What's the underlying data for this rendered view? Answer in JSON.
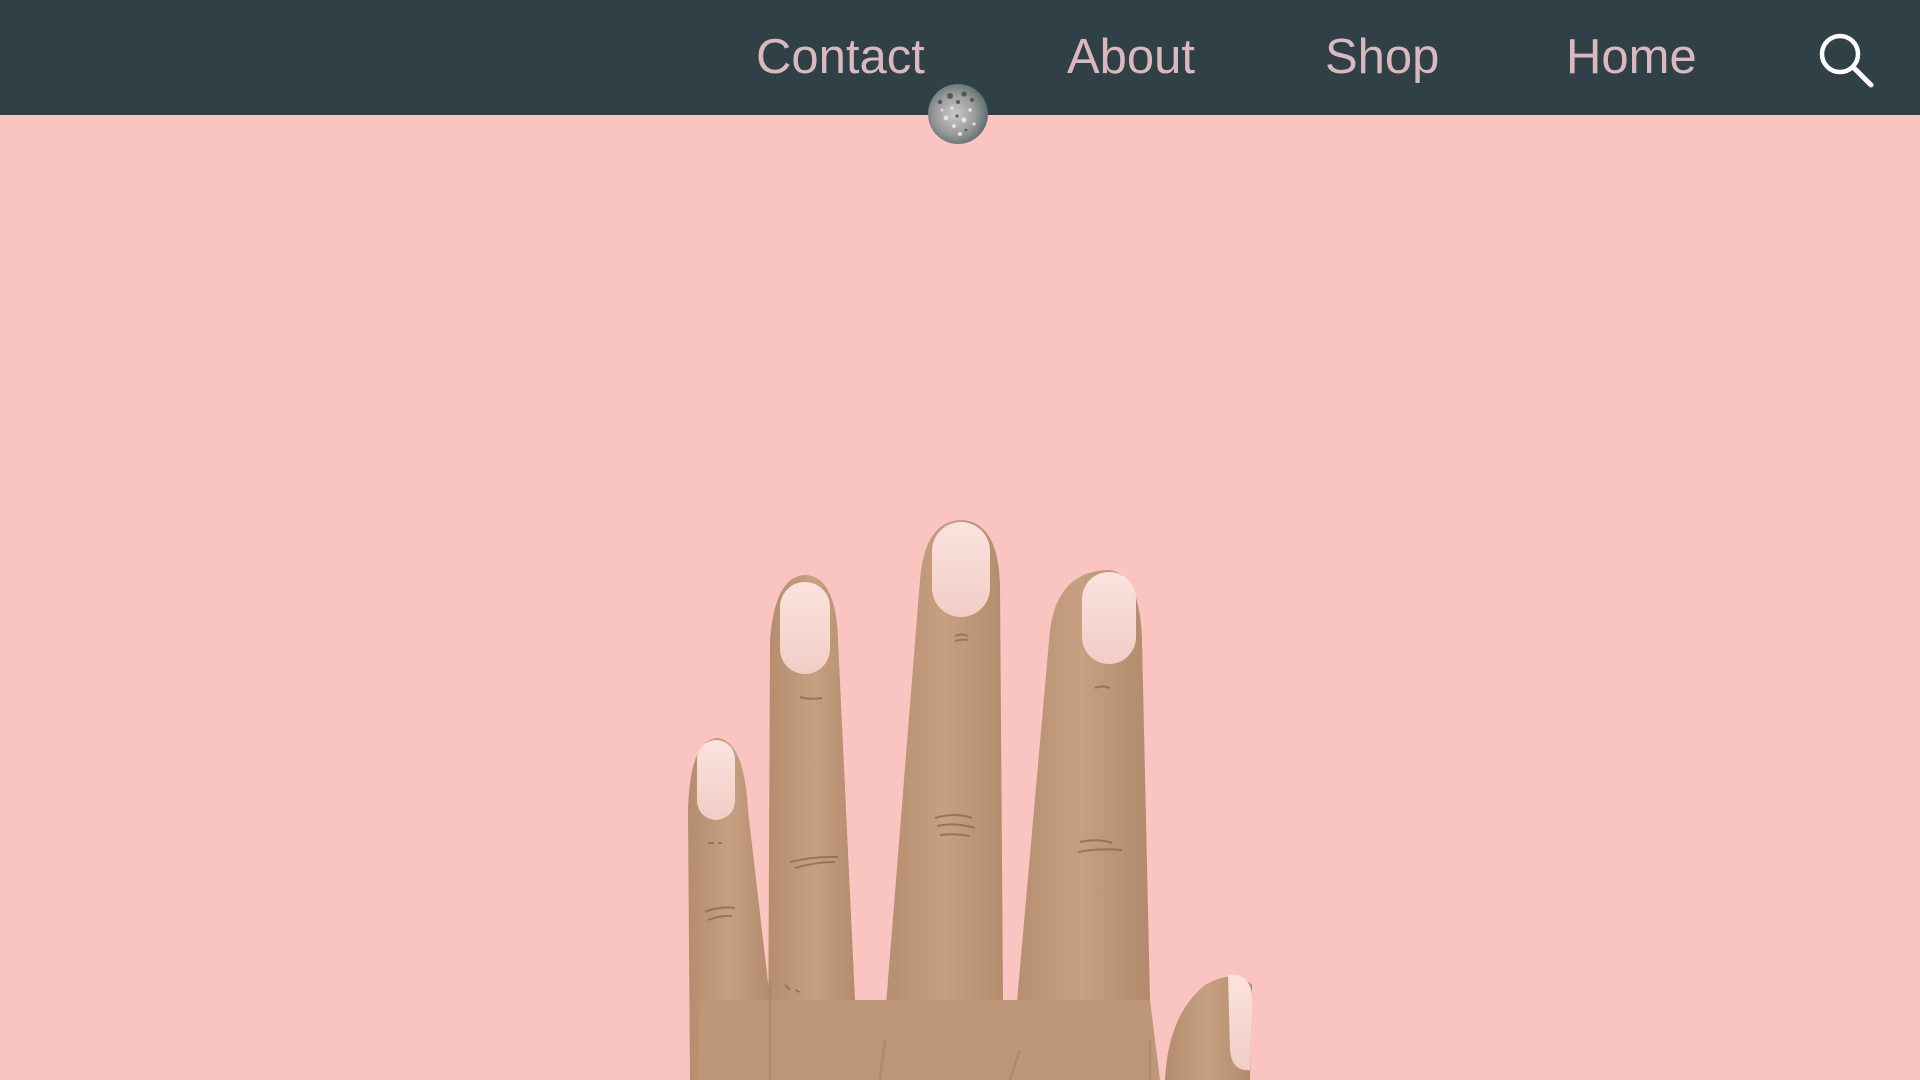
{
  "nav": {
    "links": [
      {
        "label": "Contact"
      },
      {
        "label": "About"
      },
      {
        "label": "Shop"
      },
      {
        "label": "Home"
      }
    ],
    "search_icon": "search-icon"
  },
  "hero": {
    "illustration": "hand-with-nails-illustration",
    "decoration": "glitter-ring-gem"
  },
  "colors": {
    "navbar": "#304047",
    "nav_text": "#dbb8bd",
    "background": "#fac4c1",
    "skin": "#bf9a7a",
    "nail": "#f6d5cf"
  }
}
